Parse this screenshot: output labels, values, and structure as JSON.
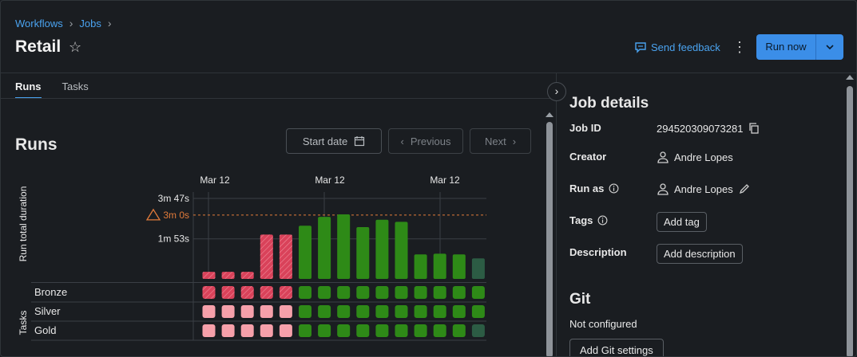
{
  "breadcrumb": [
    "Workflows",
    "Jobs"
  ],
  "title": "Retail",
  "header": {
    "feedback_label": "Send feedback",
    "run_now_label": "Run now"
  },
  "tabs": [
    {
      "label": "Runs",
      "active": true
    },
    {
      "label": "Tasks",
      "active": false
    }
  ],
  "runs_section": {
    "heading": "Runs",
    "start_date_label": "Start date",
    "previous_label": "Previous",
    "next_label": "Next"
  },
  "chart_data": {
    "type": "bar",
    "ylabel": "Run total duration",
    "x_tick_labels": [
      "Mar 12",
      "Mar 12",
      "Mar 12"
    ],
    "y_tick_labels": [
      "3m 47s",
      "1m 53s"
    ],
    "threshold_label": "3m 0s",
    "threshold_seconds": 180,
    "ylim_seconds": [
      0,
      227
    ],
    "values_seconds": [
      20,
      20,
      20,
      125,
      125,
      150,
      175,
      182,
      146,
      167,
      161,
      69,
      71,
      69,
      58
    ],
    "status": [
      "failed",
      "failed",
      "failed",
      "failed",
      "failed",
      "succeeded",
      "succeeded",
      "succeeded",
      "succeeded",
      "succeeded",
      "succeeded",
      "succeeded",
      "succeeded",
      "succeeded",
      "queued"
    ],
    "tasks_label": "Tasks",
    "tasks": [
      {
        "name": "Bronze",
        "status": [
          "failed",
          "failed",
          "failed",
          "failed",
          "failed",
          "succeeded",
          "succeeded",
          "succeeded",
          "succeeded",
          "succeeded",
          "succeeded",
          "succeeded",
          "succeeded",
          "succeeded",
          "succeeded"
        ]
      },
      {
        "name": "Silver",
        "status": [
          "skipped",
          "skipped",
          "skipped",
          "skipped",
          "skipped",
          "succeeded",
          "succeeded",
          "succeeded",
          "succeeded",
          "succeeded",
          "succeeded",
          "succeeded",
          "succeeded",
          "succeeded",
          "succeeded"
        ]
      },
      {
        "name": "Gold",
        "status": [
          "skipped",
          "skipped",
          "skipped",
          "skipped",
          "skipped",
          "succeeded",
          "succeeded",
          "succeeded",
          "succeeded",
          "succeeded",
          "succeeded",
          "succeeded",
          "succeeded",
          "succeeded",
          "queued"
        ]
      }
    ],
    "colors": {
      "failed": "#d9425a",
      "succeeded": "#2e8a17",
      "skipped": "#f6a0aa",
      "queued": "#2c5c44",
      "threshold": "#e27b3a"
    }
  },
  "job_details": {
    "heading": "Job details",
    "job_id_label": "Job ID",
    "job_id": "294520309073281",
    "creator_label": "Creator",
    "creator": "Andre Lopes",
    "run_as_label": "Run as",
    "run_as": "Andre Lopes",
    "tags_label": "Tags",
    "add_tag_label": "Add tag",
    "description_label": "Description",
    "add_description_label": "Add description"
  },
  "git": {
    "heading": "Git",
    "status": "Not configured",
    "add_label": "Add Git settings"
  }
}
